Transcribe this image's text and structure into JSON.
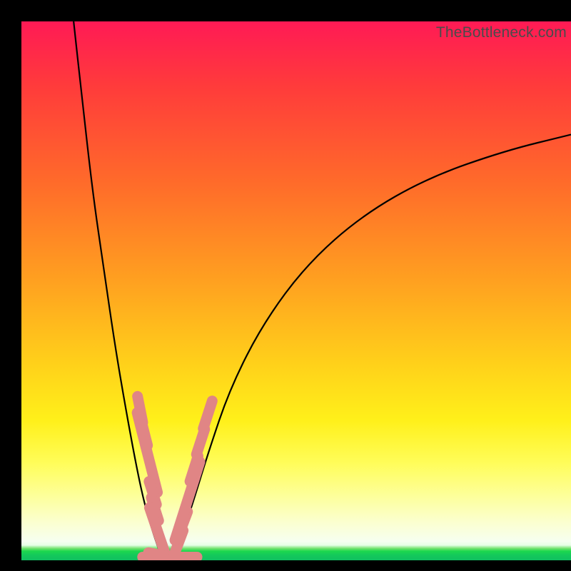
{
  "watermark": "TheBottleneck.com",
  "colors": {
    "frame": "#000000",
    "curve": "#000000",
    "bead": "#e08585",
    "gradient_top": "#ff1a55",
    "gradient_mid": "#ffd21a",
    "gradient_bottom_green": "#14c95a"
  },
  "chart_data": {
    "type": "line",
    "title": "",
    "xlabel": "",
    "ylabel": "",
    "xlim": [
      0,
      100
    ],
    "ylim": [
      0,
      100
    ],
    "grid": false,
    "legend": false,
    "note": "Axes unlabeled in source; x ~ relative horizontal position, y ~ relative height (100 = top of plot, 0 = bottom). Values estimated from image.",
    "series": [
      {
        "name": "left-arm",
        "x": [
          9.5,
          11,
          13,
          15,
          17,
          19,
          21,
          22.5,
          24,
          25,
          25.5
        ],
        "values": [
          100,
          86,
          68,
          54,
          40,
          28,
          17,
          10,
          5,
          2,
          0.5
        ]
      },
      {
        "name": "right-arm",
        "x": [
          27.5,
          29,
          31,
          34,
          38,
          44,
          52,
          62,
          74,
          88,
          100
        ],
        "values": [
          0.5,
          4,
          10,
          20,
          32,
          44,
          55,
          64,
          71,
          76,
          79
        ]
      },
      {
        "name": "valley-floor",
        "x": [
          25.5,
          26.5,
          27.5
        ],
        "values": [
          0.5,
          0.3,
          0.5
        ]
      }
    ],
    "bead_markers": {
      "note": "Pink rounded data-point markers clustered near valley; positions in same 0-100 space, len = approximate marker length along curve tangent.",
      "points": [
        {
          "arm": "left",
          "x": 21.6,
          "y": 28.0,
          "len": 2.2
        },
        {
          "arm": "left",
          "x": 22.4,
          "y": 23.5,
          "len": 2.0
        },
        {
          "arm": "left",
          "x": 22.9,
          "y": 20.0,
          "len": 6.8
        },
        {
          "arm": "left",
          "x": 23.9,
          "y": 12.5,
          "len": 2.0
        },
        {
          "arm": "left",
          "x": 24.3,
          "y": 9.5,
          "len": 2.0
        },
        {
          "arm": "left",
          "x": 24.9,
          "y": 5.0,
          "len": 4.5
        },
        {
          "arm": "floor",
          "x": 25.7,
          "y": 0.9,
          "len": 2.4
        },
        {
          "arm": "floor",
          "x": 27.0,
          "y": 0.6,
          "len": 4.5
        },
        {
          "arm": "right",
          "x": 28.5,
          "y": 3.0,
          "len": 2.4
        },
        {
          "arm": "right",
          "x": 29.3,
          "y": 6.5,
          "len": 2.4
        },
        {
          "arm": "right",
          "x": 30.2,
          "y": 11.0,
          "len": 6.8
        },
        {
          "arm": "right",
          "x": 31.4,
          "y": 17.0,
          "len": 2.2
        },
        {
          "arm": "right",
          "x": 32.6,
          "y": 22.0,
          "len": 2.2
        },
        {
          "arm": "right",
          "x": 33.9,
          "y": 27.0,
          "len": 2.4
        }
      ]
    }
  }
}
